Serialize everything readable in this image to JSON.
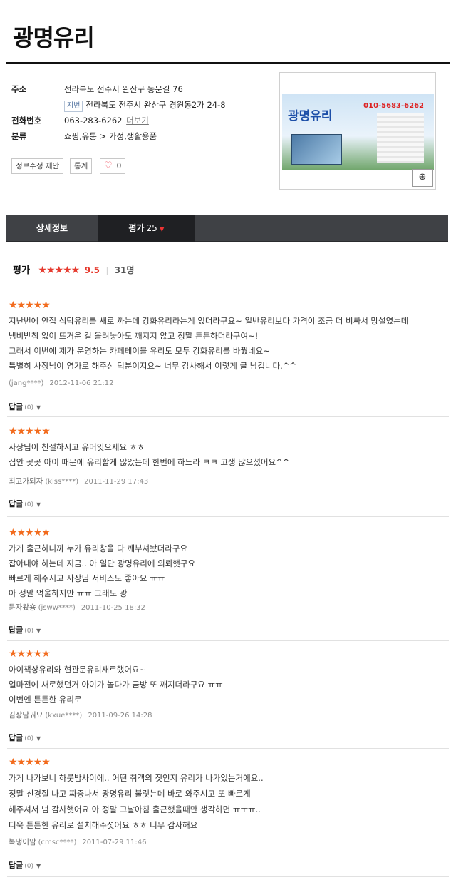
{
  "page_title": "광명유리",
  "info": {
    "address_label": "주소",
    "address": "전라북도 전주시 완산구 동문길 76",
    "jibun_badge": "지번",
    "jibun_address": "전라북도 전주시 완산구 경원동2가 24-8",
    "more_link": "더보기",
    "phone_label": "전화번호",
    "phone": "063-283-6262",
    "category_label": "분류",
    "category": "쇼핑,유통 > 가정,생활용품"
  },
  "buttons": {
    "edit_info": "정보수정 제안",
    "stats": "통계",
    "like_count": "0"
  },
  "photo": {
    "sign_name": "광명유리",
    "sign_phone": "010-5683-6262"
  },
  "tabs": [
    {
      "label": "상세정보"
    },
    {
      "label": "평가",
      "count": "25"
    }
  ],
  "rating": {
    "label": "평가",
    "stars": "★★★★★",
    "score": "9.5",
    "count": "31명"
  },
  "reviews": [
    {
      "stars": "★★★★★",
      "lines": [
        "지난번에 안집 식탁유리를 새로 까는데 강화유리라는게 있더라구요~ 일반유리보다 가격이 조금 더 비싸서 망설였는데",
        "냄비받침 없이 뜨거운 걸 올려놓아도 깨지지 않고 정말 튼튼하더라구여~!",
        "그래서 이번에 제가 운영하는 카페테이블 유리도 모두 강화유리를 바꿨네요~",
        "특별히 사장님이 염가로 해주신 덕분이지요~ 너무 감사해서 이렇게 글 남깁니다.^^"
      ],
      "nickname": "",
      "user": "(jang****)",
      "date": "2012-11-06 21:12",
      "reply_label": "답글",
      "reply_count": "(0)"
    },
    {
      "stars": "★★★★★",
      "lines": [
        "사장님이 친절하시고 유머잇으세요 ㅎㅎ",
        "집안 곳곳 아이 때문에 유리할게 많았는데 한번에 하느라 ㅋㅋ 고생 많으셨어요^^"
      ],
      "nickname": "최고가되자",
      "user": "(kiss****)",
      "date": "2011-11-29 17:43",
      "reply_label": "답글",
      "reply_count": "(0)"
    },
    {
      "stars": "★★★★★",
      "lines": [
        "가게 출근하니까 누가 유리창을 다 깨부셔놨더라구요 ㅡㅡ",
        "잡아내야 하는데 지금.. 아 일단 광명유리에 의뢰햇구요",
        "빠르게 해주시고 사장님 서비스도 좋아요 ㅠㅠ",
        "아 정말 억울하지만 ㅠㅠ 그래도 광"
      ],
      "nickname": "문자왔숑",
      "user": "(jsww****)",
      "date": "2011-10-25 18:32",
      "reply_label": "답글",
      "reply_count": "(0)"
    },
    {
      "stars": "★★★★★",
      "lines": [
        "아이책상유리와 현관문유리새로했어요~",
        "얼마전에 새로했던거 아이가 놀다가 금방 또 깨지더라구요 ㅠㅠ",
        "이번엔 튼튼한 유리로"
      ],
      "nickname": "김장담궈요",
      "user": "(kxue****)",
      "date": "2011-09-26 14:28",
      "reply_label": "답글",
      "reply_count": "(0)"
    },
    {
      "stars": "★★★★★",
      "lines": [
        "가게 나가보니 하룻밤사이에.. 어떤 취객의 짓인지 유리가 나가있는거에요..",
        "정말 신경질 나고 짜증나서 광명유리 불럿는데 바로 와주시고 또 빠르게",
        "해주셔서 넘 감사햇어요 아 정말 그날아침 출근했을때만 생각하면 ㅠㅜㅠ..",
        "더욱 튼튼한 유리로 설치해주셧어요 ㅎㅎ 너무 감사해요"
      ],
      "nickname": "복댕이맘",
      "user": "(cmsc****)",
      "date": "2011-07-29 11:46",
      "reply_label": "답글",
      "reply_count": "(0)"
    }
  ]
}
